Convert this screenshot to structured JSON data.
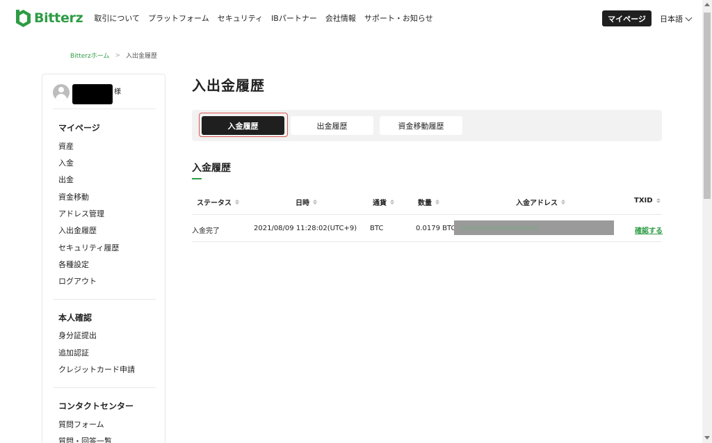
{
  "header": {
    "logo_text": "Bitterz",
    "nav": [
      "取引について",
      "プラットフォーム",
      "セキュリティ",
      "IBパートナー",
      "会社情報",
      "サポート・お知らせ"
    ],
    "mypage_button": "マイページ",
    "language": "日本語"
  },
  "breadcrumb": {
    "home": "Bitterzホーム",
    "current": "入出金履歴"
  },
  "sidebar": {
    "user_suffix": "様",
    "section_mypage": {
      "heading": "マイページ",
      "items": [
        "資産",
        "入金",
        "出金",
        "資金移動",
        "アドレス管理",
        "入出金履歴",
        "セキュリティ履歴",
        "各種設定",
        "ログアウト"
      ]
    },
    "section_identity": {
      "heading": "本人確認",
      "items": [
        "身分証提出",
        "追加認証",
        "クレジットカード申請"
      ]
    },
    "section_contact": {
      "heading": "コンタクトセンター",
      "items": [
        "質問フォーム",
        "質問・回答一覧"
      ]
    }
  },
  "main": {
    "title": "入出金履歴",
    "tabs": [
      {
        "label": "入金履歴",
        "active": true
      },
      {
        "label": "出金履歴",
        "active": false
      },
      {
        "label": "資金移動履歴",
        "active": false
      }
    ],
    "section_title": "入金履歴",
    "table": {
      "headers": [
        "ステータス",
        "日時",
        "通貨",
        "数量",
        "入金アドレス",
        "TXID"
      ],
      "rows": [
        {
          "status": "入金完了",
          "datetime": "2021/08/09 11:28:02(UTC+9)",
          "currency": "BTC",
          "amount": "0.0179 BTC",
          "txid_link": "確認する"
        }
      ]
    }
  },
  "colors": {
    "brand_green": "#2e9c45",
    "dark_button": "#1f1f1f",
    "highlight_red": "#d9534f"
  }
}
